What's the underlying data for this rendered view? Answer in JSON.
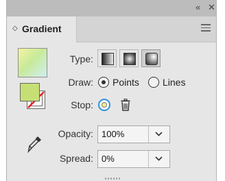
{
  "window": {
    "collapse_icon": "«",
    "close_icon": "✕"
  },
  "tab": {
    "chevron": "◇",
    "label": "Gradient"
  },
  "type": {
    "label": "Type:",
    "options": [
      {
        "name": "linear-gradient-icon",
        "selected": false
      },
      {
        "name": "radial-gradient-icon",
        "selected": false
      },
      {
        "name": "freeform-gradient-icon",
        "selected": true
      }
    ]
  },
  "draw": {
    "label": "Draw:",
    "options": [
      {
        "label": "Points",
        "selected": true
      },
      {
        "label": "Lines",
        "selected": false
      }
    ]
  },
  "stop": {
    "label": "Stop:",
    "stop_color": "#f0ed8f",
    "delete_icon": "trash-icon"
  },
  "opacity": {
    "label": "Opacity:",
    "value": "100%"
  },
  "spread": {
    "label": "Spread:",
    "value": "0%"
  },
  "colors": {
    "fill": "#c6df75",
    "accent": "#2f8fd8"
  }
}
